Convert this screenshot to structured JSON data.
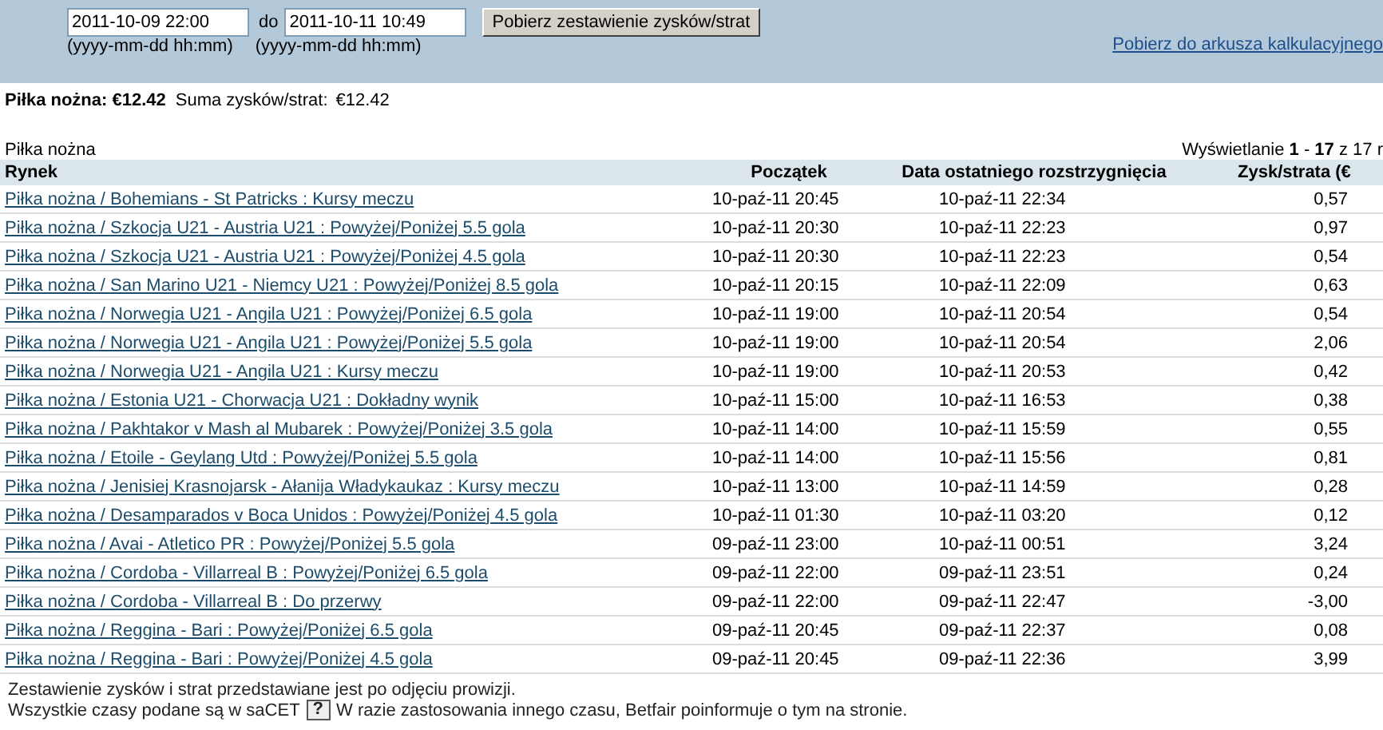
{
  "filter": {
    "from": "2011-10-09 22:00",
    "separator": "do",
    "to": "2011-10-11 10:49",
    "from_hint": "(yyyy-mm-dd hh:mm)",
    "to_hint": "(yyyy-mm-dd hh:mm)",
    "submit": "Pobierz zestawienie zysków/strat",
    "export_link": "Pobierz do arkusza kalkulacyjnego"
  },
  "summary": {
    "sport_total": "Piłka nożna: €12.42",
    "total_label": "Suma zysków/strat:",
    "total_value": "€12.42"
  },
  "section_title": "Piłka nożna",
  "paging": "Wyświetlanie **1** - **17** z 17 r",
  "table": {
    "columns": [
      "Rynek",
      "Początek",
      "Data ostatniego rozstrzygnięcia",
      "Zysk/strata (€"
    ],
    "rows": [
      [
        "Piłka nożna / Bohemians - St Patricks : Kursy meczu",
        "10-paź-11 20:45",
        "10-paź-11 22:34",
        "0,57"
      ],
      [
        "Piłka nożna / Szkocja U21 - Austria U21 : Powyżej/Poniżej 5.5 gola",
        "10-paź-11 20:30",
        "10-paź-11 22:23",
        "0,97"
      ],
      [
        "Piłka nożna / Szkocja U21 - Austria U21 : Powyżej/Poniżej 4.5 gola",
        "10-paź-11 20:30",
        "10-paź-11 22:23",
        "0,54"
      ],
      [
        "Piłka nożna / San Marino U21 - Niemcy U21 : Powyżej/Poniżej 8.5 gola",
        "10-paź-11 20:15",
        "10-paź-11 22:09",
        "0,63"
      ],
      [
        "Piłka nożna / Norwegia U21 - Angila U21 : Powyżej/Poniżej 6.5 gola",
        "10-paź-11 19:00",
        "10-paź-11 20:54",
        "0,54"
      ],
      [
        "Piłka nożna / Norwegia U21 - Angila U21 : Powyżej/Poniżej 5.5 gola",
        "10-paź-11 19:00",
        "10-paź-11 20:54",
        "2,06"
      ],
      [
        "Piłka nożna / Norwegia U21 - Angila U21 : Kursy meczu",
        "10-paź-11 19:00",
        "10-paź-11 20:53",
        "0,42"
      ],
      [
        "Piłka nożna / Estonia U21 - Chorwacja U21 : Dokładny wynik",
        "10-paź-11 15:00",
        "10-paź-11 16:53",
        "0,38"
      ],
      [
        "Piłka nożna / Pakhtakor v Mash al Mubarek : Powyżej/Poniżej 3.5 gola",
        "10-paź-11 14:00",
        "10-paź-11 15:59",
        "0,55"
      ],
      [
        "Piłka nożna / Etoile - Geylang Utd : Powyżej/Poniżej 5.5 gola",
        "10-paź-11 14:00",
        "10-paź-11 15:56",
        "0,81"
      ],
      [
        "Piłka nożna / Jenisiej Krasnojarsk - Ałanija Władykaukaz : Kursy meczu",
        "10-paź-11 13:00",
        "10-paź-11 14:59",
        "0,28"
      ],
      [
        "Piłka nożna / Desamparados v Boca Unidos : Powyżej/Poniżej 4.5 gola",
        "10-paź-11 01:30",
        "10-paź-11 03:20",
        "0,12"
      ],
      [
        "Piłka nożna / Avai - Atletico PR : Powyżej/Poniżej 5.5 gola",
        "09-paź-11 23:00",
        "10-paź-11 00:51",
        "3,24"
      ],
      [
        "Piłka nożna / Cordoba - Villarreal B : Powyżej/Poniżej 6.5 gola",
        "09-paź-11 22:00",
        "09-paź-11 23:51",
        "0,24"
      ],
      [
        "Piłka nożna / Cordoba - Villarreal B : Do przerwy",
        "09-paź-11 22:00",
        "09-paź-11 22:47",
        "-3,00"
      ],
      [
        "Piłka nożna / Reggina - Bari : Powyżej/Poniżej 6.5 gola",
        "09-paź-11 20:45",
        "09-paź-11 22:37",
        "0,08"
      ],
      [
        "Piłka nożna / Reggina - Bari : Powyżej/Poniżej 4.5 gola",
        "09-paź-11 20:45",
        "09-paź-11 22:36",
        "3,99"
      ]
    ]
  },
  "notes": {
    "commission": "Zestawienie zysków i strat przedstawiane jest po odjęciu prowizji.",
    "timezone_before": "Wszystkie czasy podane są w saCET",
    "help": "?",
    "timezone_after": "W razie zastosowania innego czasu, Betfair poinformuje o tym na stronie."
  }
}
